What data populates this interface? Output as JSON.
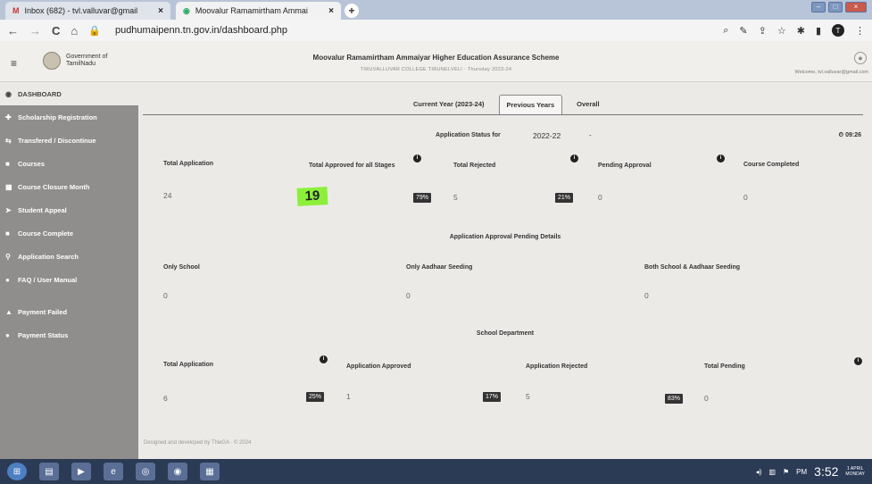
{
  "browser": {
    "tabs": [
      {
        "title": "Inbox (682) - tvl.valluvar@gmail",
        "icon": "gmail-icon"
      },
      {
        "title": "Moovalur Ramamirtham Ammai",
        "icon": "site-icon"
      }
    ],
    "url": "pudhumaipenn.tn.gov.in/dashboard.php",
    "avatar_letter": "T"
  },
  "header": {
    "govt_line1": "Government of",
    "govt_line2": "TamilNadu",
    "scheme_title": "Moovalur Ramamirtham Ammaiyar Higher Education Assurance Scheme",
    "scheme_sub": "TIRUVALLUVAR COLLEGE TIRUNELVELI · Thursday 2023-24",
    "welcome": "Welcome, tvl.valluvar@gmail.com"
  },
  "sidebar": {
    "items": [
      {
        "label": "DASHBOARD",
        "icon": "dashboard-icon"
      },
      {
        "label": "Scholarship Registration",
        "icon": "registration-icon"
      },
      {
        "label": "Transfered / Discontinue",
        "icon": "transfer-icon"
      },
      {
        "label": "Courses",
        "icon": "courses-icon"
      },
      {
        "label": "Course Closure Month",
        "icon": "calendar-icon"
      },
      {
        "label": "Student Appeal",
        "icon": "appeal-icon"
      },
      {
        "label": "Course Complete",
        "icon": "complete-icon"
      },
      {
        "label": "Application Search",
        "icon": "search-icon"
      },
      {
        "label": "FAQ / User Manual",
        "icon": "help-icon"
      },
      {
        "label": "Payment Failed",
        "icon": "warning-icon"
      },
      {
        "label": "Payment Status",
        "icon": "status-icon"
      }
    ]
  },
  "tabs": [
    "Current Year (2023-24)",
    "Previous Years",
    "Overall"
  ],
  "status": {
    "label": "Application Status for",
    "year": "2022-22",
    "caret": "-",
    "clock": "09:26"
  },
  "stats": {
    "total_application_label": "Total Application",
    "total_application": "24",
    "approved_label": "Total Approved for all Stages",
    "approved_highlight": "19",
    "approved_pct": "79%",
    "rejected_label": "Total Rejected",
    "rejected": "5",
    "rejected_pct": "21%",
    "pending_label": "Pending Approval",
    "pending": "0",
    "completed_label": "Course Completed",
    "completed": "0"
  },
  "pending_details": {
    "title": "Application Approval Pending Details",
    "only_school_label": "Only School",
    "only_school": "0",
    "only_aadhaar_label": "Only Aadhaar Seeding",
    "only_aadhaar": "0",
    "both_label": "Both School & Aadhaar Seeding",
    "both": "0"
  },
  "school_dept": {
    "title": "School Department",
    "total_label": "Total Application",
    "total": "6",
    "total_pct": "25%",
    "approved_label": "Application Approved",
    "approved": "1",
    "approved_pct": "17%",
    "rejected_label": "Application Rejected",
    "rejected": "5",
    "rejected_pct": "83%",
    "pending_label": "Total Pending",
    "pending": "0"
  },
  "footer": "Designed and developed by TNeGA · © 2024",
  "taskbar": {
    "time": "3:52",
    "ampm": "PM",
    "date_line1": "1 APRIL",
    "date_line2": "MONDAY"
  },
  "info_glyph": "i"
}
